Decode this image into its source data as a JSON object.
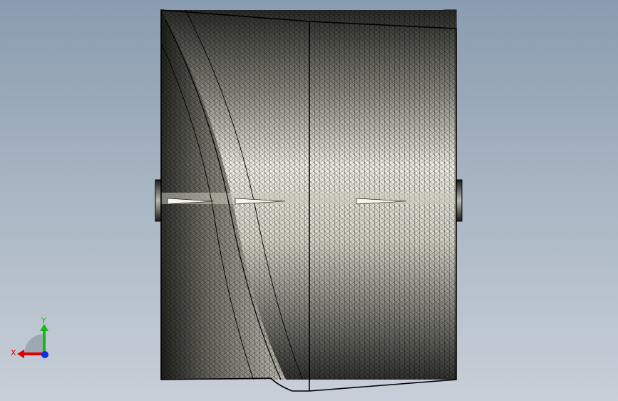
{
  "triad": {
    "x_label": "X",
    "y_label": "Y",
    "colors": {
      "x": "#e00000",
      "y": "#18b818",
      "z": "#1030e0"
    }
  },
  "model": {
    "mesh_color": "#ecece2",
    "shade_color": "#1c1c1a",
    "line_color": "#000000"
  }
}
